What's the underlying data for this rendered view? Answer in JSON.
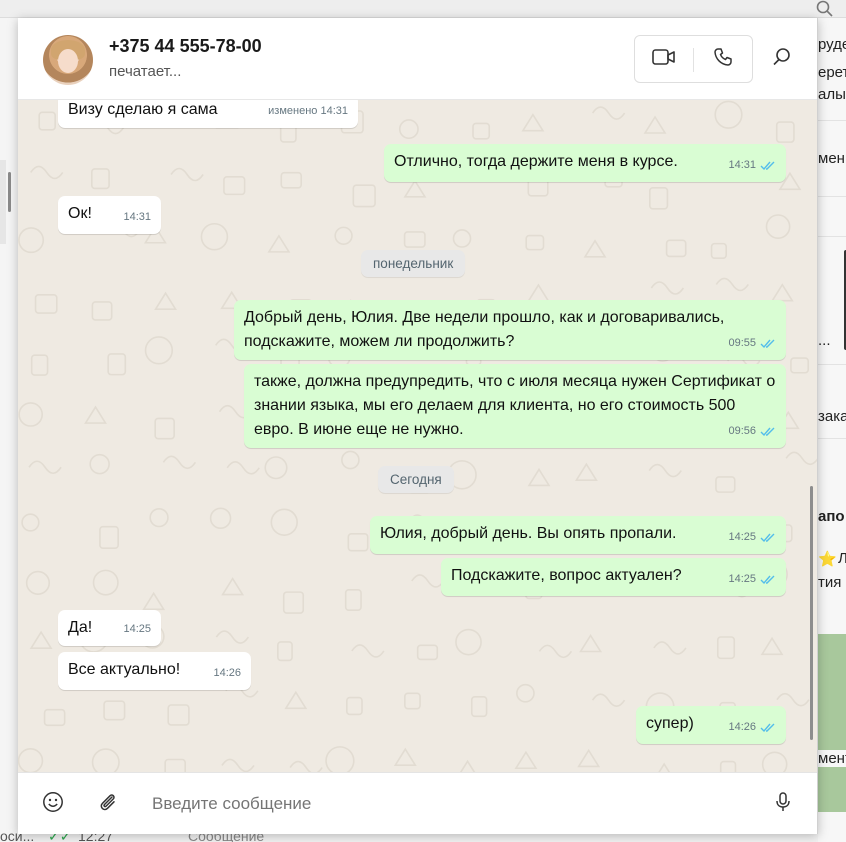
{
  "header": {
    "contact_name": "+375 44 555-78-00",
    "status": "печатает...",
    "video_icon": "video-camera-icon",
    "call_icon": "phone-icon",
    "search_icon": "search-icon"
  },
  "messages": [
    {
      "direction": "in",
      "text": "Визу сделаю я сама",
      "time": "изменено 14:31"
    },
    {
      "direction": "out",
      "text": "Отлично, тогда держите меня в курсе.",
      "time": "14:31",
      "read": true
    },
    {
      "direction": "in",
      "text": "Ок!",
      "time": "14:31"
    },
    {
      "type": "day",
      "text": "понедельник"
    },
    {
      "direction": "out",
      "text": "Добрый день, Юлия. Две недели прошло, как и договаривались, подскажите, можем ли продолжить?",
      "time": "09:55",
      "read": true
    },
    {
      "direction": "out",
      "text": "также, должна предупредить, что с июля месяца нужен Сертификат о знании языка, мы его делаем для клиента, но его стоимость 500 евро. В июне еще не нужно.",
      "time": "09:56",
      "read": true
    },
    {
      "type": "day",
      "text": "Сегодня"
    },
    {
      "direction": "out",
      "text": "Юлия, добрый день. Вы опять пропали.",
      "time": "14:25",
      "read": true
    },
    {
      "direction": "out",
      "text": "Подскажите, вопрос актуален?",
      "time": "14:25",
      "read": true
    },
    {
      "direction": "in",
      "text": "Да!",
      "time": "14:25"
    },
    {
      "direction": "in",
      "text": "Все актуально!",
      "time": "14:26"
    },
    {
      "direction": "out",
      "text": "супер)",
      "time": "14:26",
      "read": true
    }
  ],
  "composer": {
    "placeholder": "Введите сообщение",
    "emoji_icon": "smiley-icon",
    "attach_icon": "paperclip-icon",
    "mic_icon": "microphone-icon"
  },
  "background": {
    "right_fragments": [
      "руде",
      "ерет",
      "алы",
      "мен",
      "...",
      "зака",
      "апо",
      "Л",
      "тия",
      "мент"
    ],
    "bottom_fragments": [
      "оси...",
      "12:27",
      "Сообщение"
    ]
  },
  "colors": {
    "outgoing_bubble": "#d9fdd3",
    "incoming_bubble": "#ffffff",
    "chat_wallpaper": "#efeae2",
    "read_ticks": "#53bdeb"
  }
}
